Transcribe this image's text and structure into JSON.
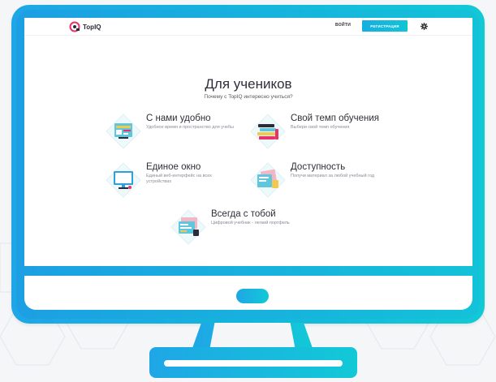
{
  "header": {
    "logo_text": "TopIQ",
    "login_label": "ВОЙТИ",
    "register_label": "РЕГИСТРАЦИЯ",
    "settings_icon": "gear-icon"
  },
  "main": {
    "title": "Для учеников",
    "subtitle": "Почему с TopIQ интересно учиться?",
    "features": [
      {
        "title": "С нами удобно",
        "description": "Удобное время и пространство для учебы",
        "icon": "calendar-icon"
      },
      {
        "title": "Свой темп обучения",
        "description": "Выбери свой темп обучения",
        "icon": "books-icon"
      },
      {
        "title": "Единое окно",
        "description": "Единый веб-интерфейс на всех устройствах",
        "icon": "monitor-icon"
      },
      {
        "title": "Доступность",
        "description": "Получи материал за любой учебный год",
        "icon": "documents-icon"
      },
      {
        "title": "Всегда с тобой",
        "description": "Цифровой учебник - легкий портфель",
        "icon": "textbook-icon"
      }
    ]
  },
  "colors": {
    "accent_start": "#1fa6e6",
    "accent_end": "#12c9d6",
    "text_dark": "#2f2f3a",
    "text_muted": "#8a8a96"
  }
}
